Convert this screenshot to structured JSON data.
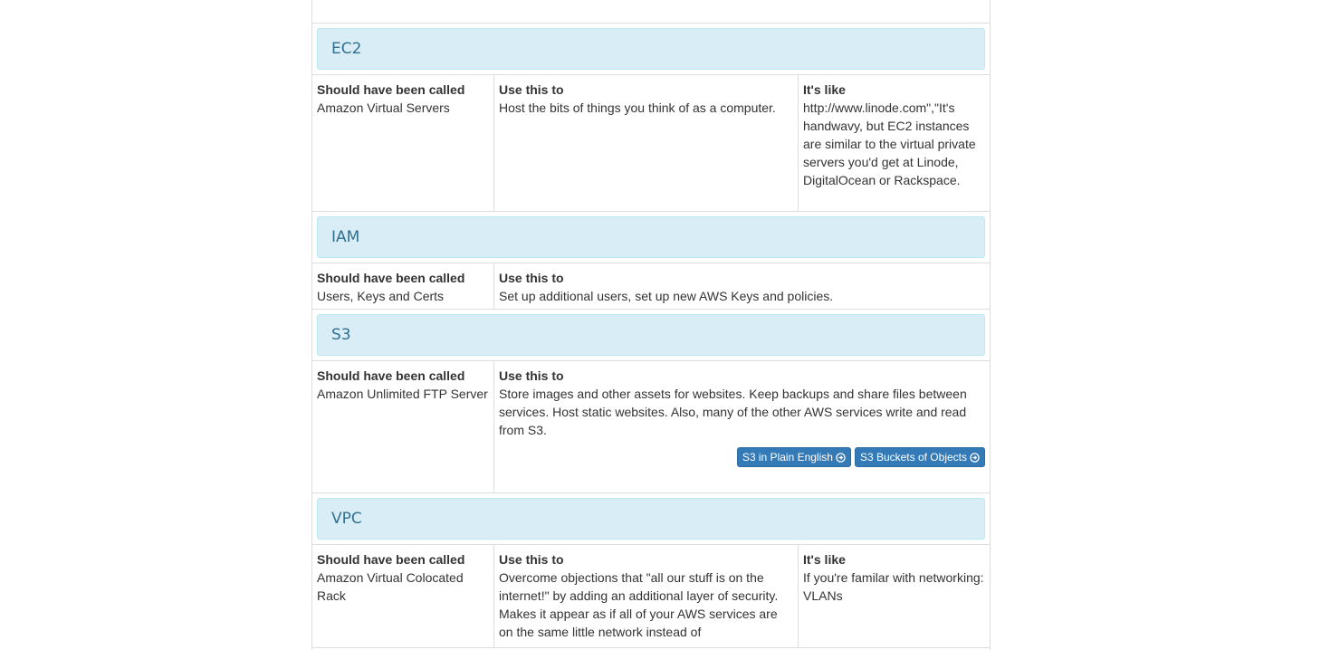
{
  "sections": [
    {
      "title": "EC2",
      "called_label": "Should have been called",
      "called_value": "Amazon Virtual Servers",
      "use_label": "Use this to",
      "use_value": "Host the bits of things you think of as a computer.",
      "like_label": "It's like",
      "like_value": "http://www.linode.com\",\"It's handwavy, but EC2 instances are similar to the virtual private servers you'd get at Linode, DigitalOcean or Rackspace."
    },
    {
      "title": "IAM",
      "called_label": "Should have been called",
      "called_value": "Users, Keys and Certs",
      "use_label": "Use this to",
      "use_value": "Set up additional users, set up new AWS Keys and policies."
    },
    {
      "title": "S3",
      "called_label": "Should have been called",
      "called_value": "Amazon Unlimited FTP Server",
      "use_label": "Use this to",
      "use_value": "Store images and other assets for websites. Keep backups and share files between services. Host static websites. Also, many of the other AWS services write and read from S3.",
      "buttons": [
        {
          "label": "S3 in Plain English",
          "icon": "arrow-circle-right-icon"
        },
        {
          "label": "S3 Buckets of Objects",
          "icon": "arrow-circle-right-icon"
        }
      ]
    },
    {
      "title": "VPC",
      "called_label": "Should have been called",
      "called_value": "Amazon Virtual Colocated Rack",
      "use_label": "Use this to",
      "use_value": "Overcome objections that \"all our stuff is on the internet!\" by adding an additional layer of security. Makes it appear as if all of your AWS services are on the same little network instead of",
      "like_label": "It's like",
      "like_value": "If you're familar with networking: VLANs"
    }
  ],
  "colors": {
    "header_bg": "#d9edf7",
    "header_text": "#31708f",
    "button_bg": "#337ab7"
  }
}
